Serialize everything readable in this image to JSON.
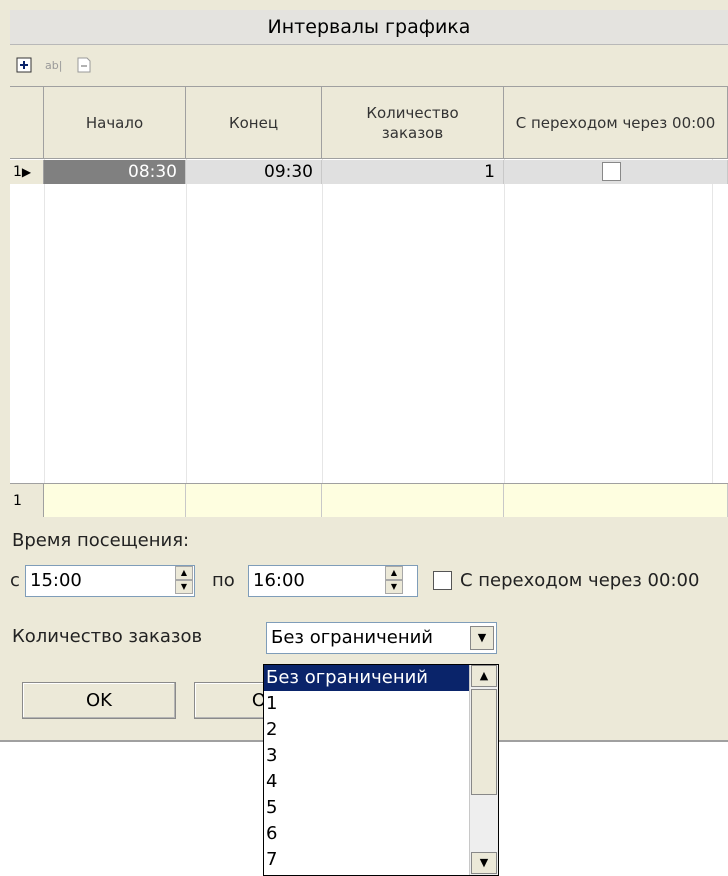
{
  "window": {
    "title": "Интервалы графика"
  },
  "toolbar": {
    "buttons": [
      "add-row",
      "edit-row",
      "delete-row"
    ]
  },
  "grid": {
    "columns": [
      "Начало",
      "Конец",
      "Количество заказов",
      "С переходом через 00:00"
    ],
    "rows": [
      {
        "indicator": "1",
        "start": "08:30",
        "end": "09:30",
        "count": "1",
        "crossing": false
      }
    ],
    "footer_indicator": "1"
  },
  "visit": {
    "label": "Время посещения:",
    "from_label": "с",
    "from_value": "15:00",
    "to_label": "по",
    "to_value": "16:00",
    "crossing_label": "С переходом через 00:00",
    "crossing_checked": false
  },
  "orders": {
    "label": "Количество заказов",
    "selected": "Без ограничений",
    "options": [
      "Без ограничений",
      "1",
      "2",
      "3",
      "4",
      "5",
      "6",
      "7"
    ]
  },
  "buttons": {
    "ok": "OK",
    "cancel_partial": "Отм"
  }
}
